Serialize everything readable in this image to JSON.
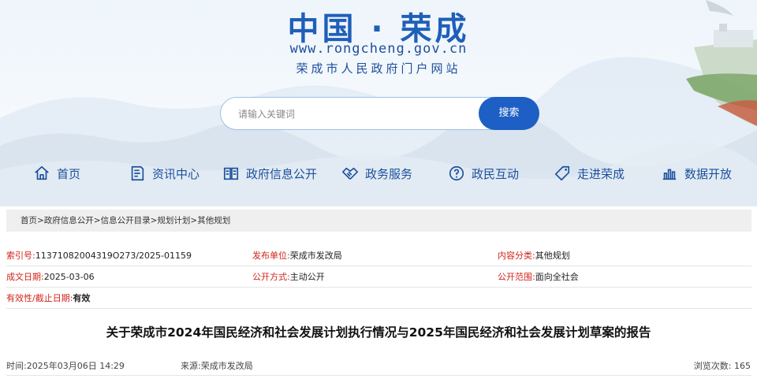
{
  "header": {
    "site_title": "中国 · 荣成",
    "site_url": "www.rongcheng.gov.cn",
    "site_subtitle": "荣成市人民政府门户网站"
  },
  "search": {
    "placeholder": "请输入关键词",
    "button_label": "搜索"
  },
  "nav": {
    "items": [
      {
        "label": "首页",
        "icon": "home-icon"
      },
      {
        "label": "资讯中心",
        "icon": "news-icon"
      },
      {
        "label": "政府信息公开",
        "icon": "book-icon"
      },
      {
        "label": "政务服务",
        "icon": "handshake-icon"
      },
      {
        "label": "政民互动",
        "icon": "question-icon"
      },
      {
        "label": "走进荣成",
        "icon": "tag-icon"
      },
      {
        "label": "数据开放",
        "icon": "bar-chart-icon"
      }
    ]
  },
  "breadcrumb": {
    "path": "首页>政府信息公开>信息公开目录>规划计划>其他规划"
  },
  "meta": {
    "index_no_label": "索引号:",
    "index_no": "11371082004319O273/2025-01159",
    "publisher_label": "发布单位:",
    "publisher": "荣成市发改局",
    "category_label": "内容分类:",
    "category": "其他规划",
    "date_label": "成文日期:",
    "date": "2025-03-06",
    "method_label": "公开方式:",
    "method": "主动公开",
    "scope_label": "公开范围:",
    "scope": "面向全社会",
    "validity_label": "有效性/截止日期:",
    "validity": "有效"
  },
  "article": {
    "title": "关于荣成市2024年国民经济和社会发展计划执行情况与2025年国民经济和社会发展计划草案的报告",
    "time_label": "时间:",
    "time": "2025年03月06日 14:29",
    "source_label": "来源:",
    "source": "荣成市发改局",
    "views_label": "浏览次数:",
    "views": "165"
  },
  "colors": {
    "brand_blue": "#1f5fb8",
    "button_blue": "#1d5fc4",
    "meta_label_red": "#d0231b"
  }
}
